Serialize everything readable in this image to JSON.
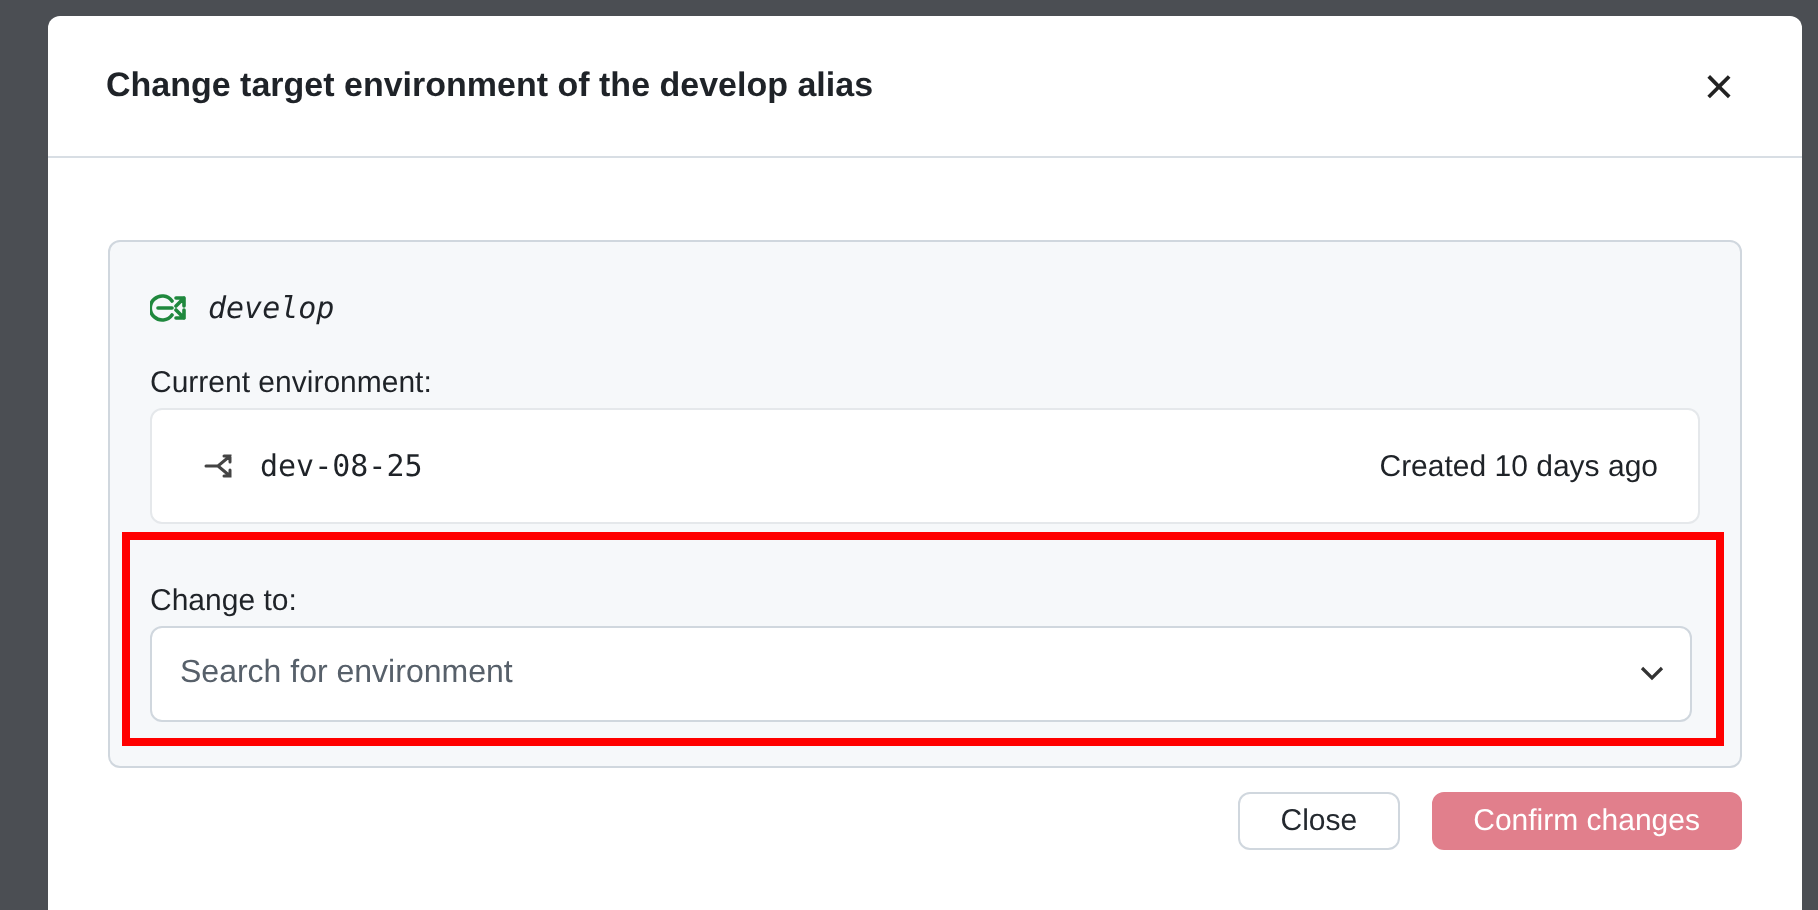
{
  "dialog": {
    "title": "Change target environment of the develop alias",
    "close_icon": "×"
  },
  "alias": {
    "name": "develop"
  },
  "current": {
    "label": "Current environment:",
    "environment": "dev-08-25",
    "created": "Created 10 days ago"
  },
  "change_to": {
    "label": "Change to:",
    "placeholder": "Search for environment"
  },
  "buttons": [
    {
      "label": "Close",
      "kind": "secondary",
      "disabled": false
    },
    {
      "label": "Confirm changes",
      "kind": "primary",
      "disabled": true
    }
  ]
}
